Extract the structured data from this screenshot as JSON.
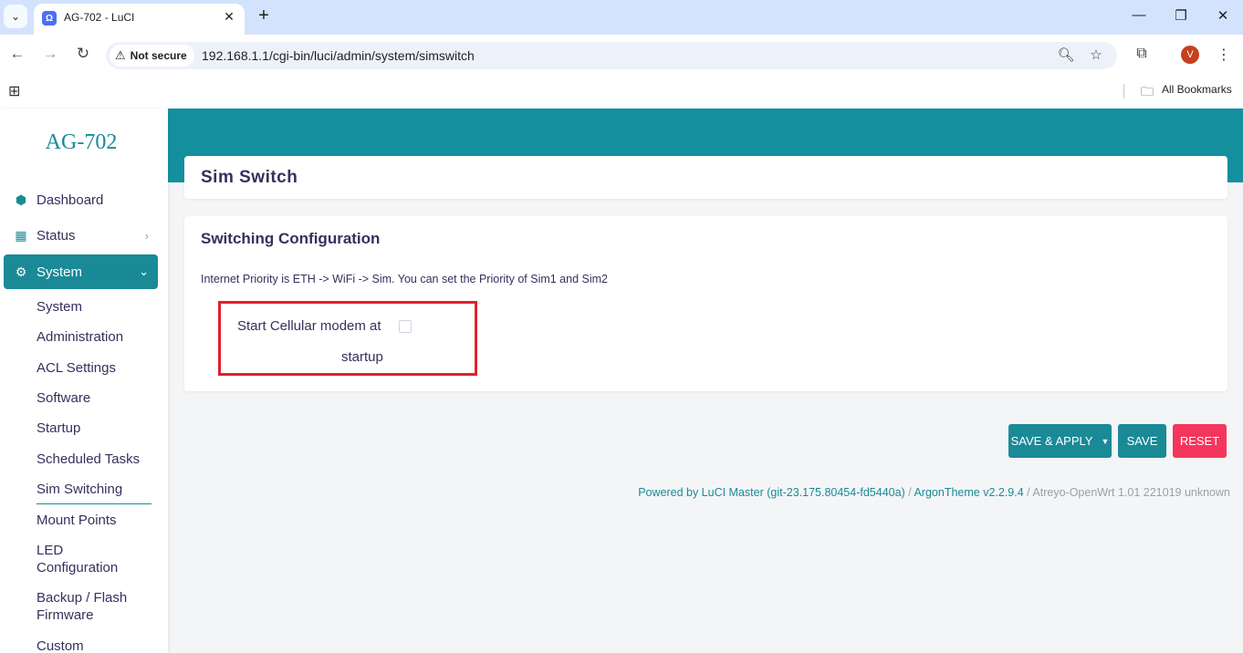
{
  "browser": {
    "tab_title": "AG-702 - LuCI",
    "security_label": "Not secure",
    "url": "192.168.1.1/cgi-bin/luci/admin/system/simswitch",
    "avatar_letter": "V",
    "bookmarks_label": "All Bookmarks"
  },
  "sidebar": {
    "brand": "AG-702",
    "nav": [
      {
        "label": "Dashboard",
        "icon": "cube-icon"
      },
      {
        "label": "Status",
        "icon": "grid-icon"
      },
      {
        "label": "System",
        "icon": "gear-icon"
      }
    ],
    "sub_items": [
      "System",
      "Administration",
      "ACL Settings",
      "Software",
      "Startup",
      "Scheduled Tasks",
      "Sim Switching",
      "Mount Points",
      "LED Configuration",
      "Backup / Flash Firmware",
      "Custom"
    ],
    "active_sub_item": "Sim Switching"
  },
  "main": {
    "page_title": "Sim Switch",
    "section_title": "Switching Configuration",
    "section_description": "Internet Priority is ETH -> WiFi -> Sim. You can set the Priority of Sim1 and Sim2",
    "option_label_line1": "Start Cellular modem at",
    "option_label_line2": "startup",
    "option_checked": false
  },
  "actions": {
    "save_apply": "SAVE & APPLY",
    "save": "SAVE",
    "reset": "RESET"
  },
  "footer": {
    "luci_link": "Powered by LuCI Master (git-23.175.80454-fd5440a)",
    "sep1": " / ",
    "theme_link": "ArgonTheme v2.2.9.4",
    "sep2": " / ",
    "build": "Atreyo-OpenWrt 1.01 221019 unknown"
  },
  "colors": {
    "accent": "#1a8a97",
    "banner": "#148f9e",
    "reset": "#f5365c",
    "highlight": "#e0202e"
  }
}
